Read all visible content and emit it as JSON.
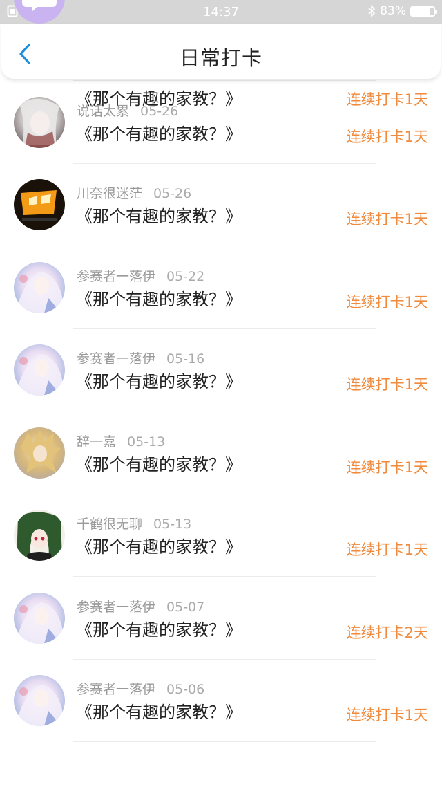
{
  "status_bar": {
    "time": "14:37",
    "battery": "83%",
    "battery_level": 0.83
  },
  "header": {
    "title": "日常打卡"
  },
  "colors": {
    "accent": "#f08a3c",
    "back": "#1a8fe0"
  },
  "entries": [
    {
      "user": "",
      "date": "",
      "book": "《那个有趣的家教？》",
      "streak": "连续打卡1天",
      "avatar": "purple-chat-icon"
    },
    {
      "user": "说话太累",
      "date": "05-26",
      "book": "《那个有趣的家教？》",
      "streak": "连续打卡1天",
      "avatar": "gray-anime"
    },
    {
      "user": "川奈很迷茫",
      "date": "05-26",
      "book": "《那个有趣的家教？》",
      "streak": "连续打卡1天",
      "avatar": "orange-anime"
    },
    {
      "user": "参赛者一落伊",
      "date": "05-22",
      "book": "《那个有趣的家教？》",
      "streak": "连续打卡1天",
      "avatar": "pastel-anime"
    },
    {
      "user": "参赛者一落伊",
      "date": "05-16",
      "book": "《那个有趣的家教？》",
      "streak": "连续打卡1天",
      "avatar": "pastel-anime"
    },
    {
      "user": "辞一嘉",
      "date": "05-13",
      "book": "《那个有趣的家教？》",
      "streak": "连续打卡1天",
      "avatar": "blond-anime"
    },
    {
      "user": "千鹤很无聊",
      "date": "05-13",
      "book": "《那个有趣的家教？》",
      "streak": "连续打卡1天",
      "avatar": "green-anime"
    },
    {
      "user": "参赛者一落伊",
      "date": "05-07",
      "book": "《那个有趣的家教？》",
      "streak": "连续打卡2天",
      "avatar": "pastel-anime"
    },
    {
      "user": "参赛者一落伊",
      "date": "05-06",
      "book": "《那个有趣的家教？》",
      "streak": "连续打卡1天",
      "avatar": "pastel-anime"
    }
  ]
}
